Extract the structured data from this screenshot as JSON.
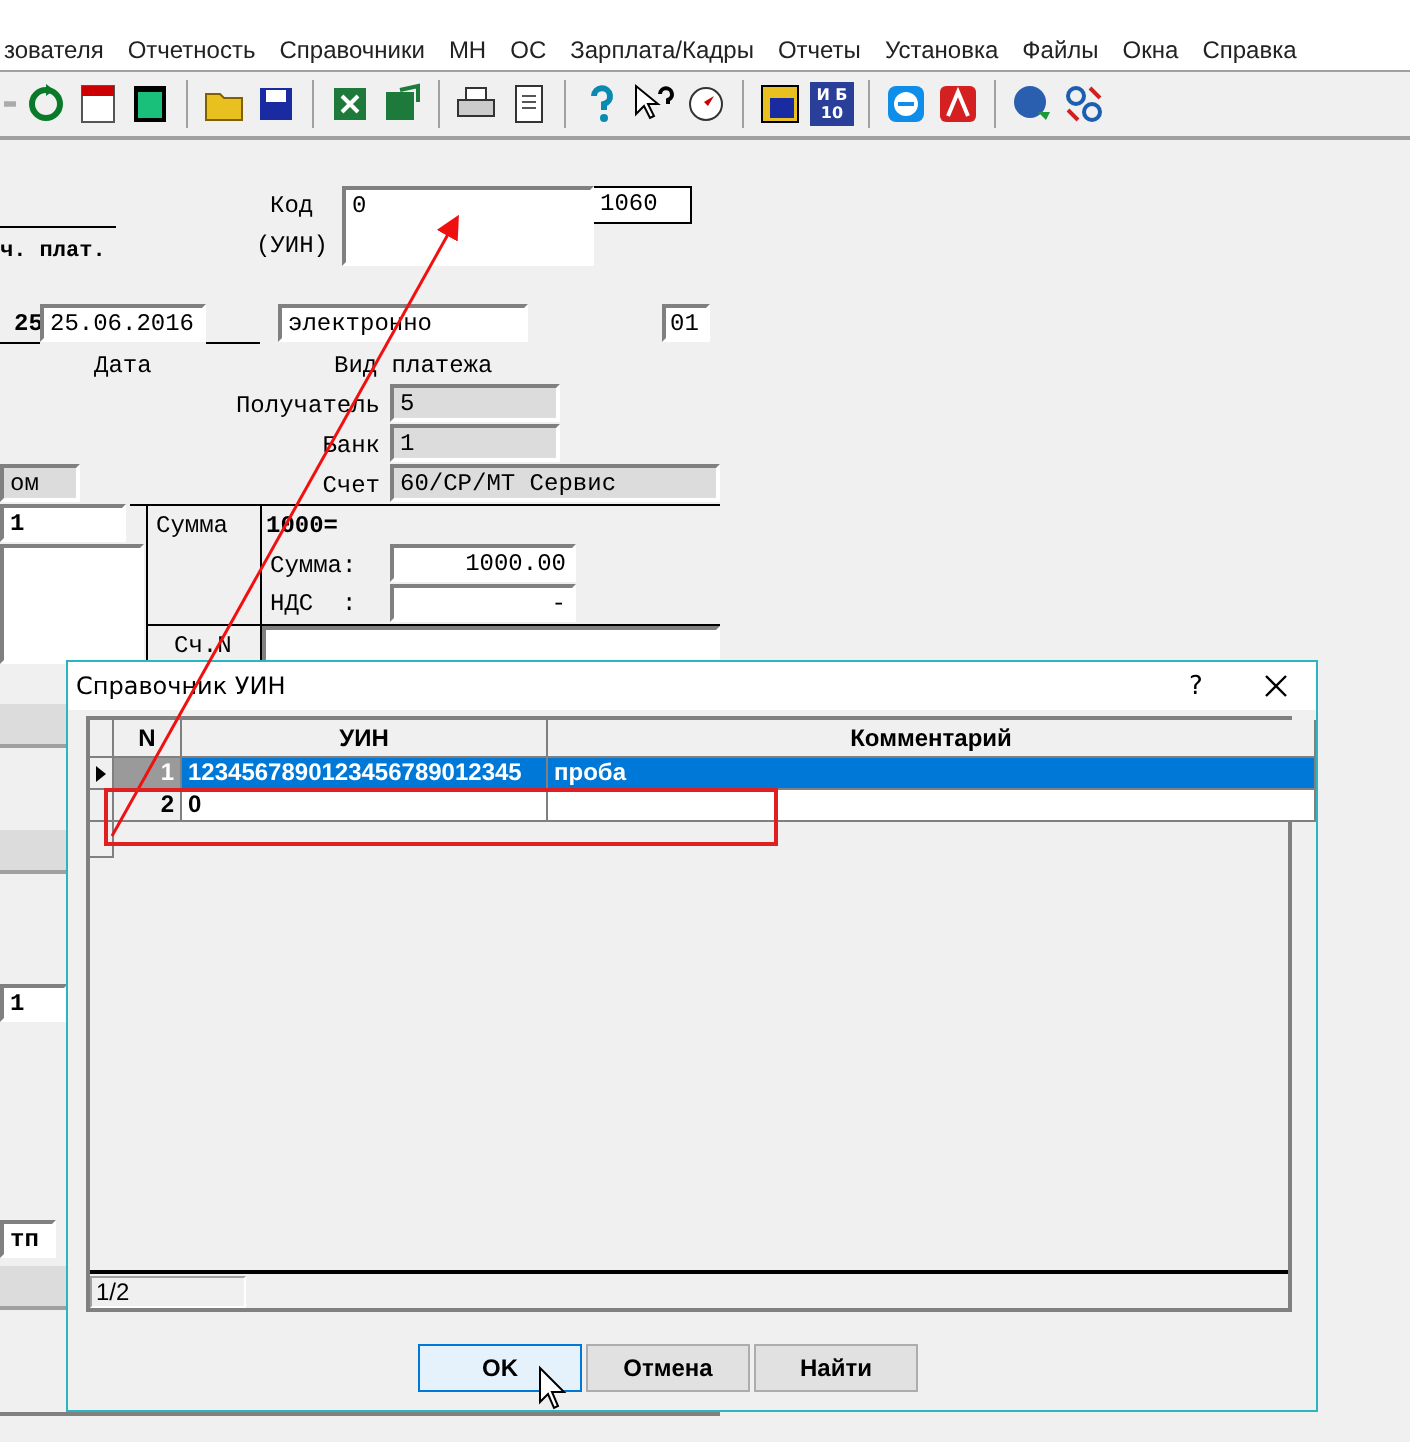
{
  "menu": [
    "зователя",
    "Отчетность",
    "Справочники",
    "МН",
    "ОС",
    "Зарплата/Кадры",
    "Отчеты",
    "Установка",
    "Файлы",
    "Окна",
    "Справка"
  ],
  "toolbar": {
    "badge_lines": [
      "И Б",
      "10"
    ]
  },
  "form": {
    "code": {
      "label": "Код",
      "sublabel": "(УИН)",
      "value": "0",
      "extra": "1060"
    },
    "payer_caption": "ч. плат.",
    "number_tail": "25",
    "date": {
      "value": "25.06.2016",
      "label": "Дата"
    },
    "payment_type": {
      "value": "электронно",
      "label": "Вид платежа"
    },
    "priority": "01",
    "recipient": {
      "label": "Получатель",
      "value": "5"
    },
    "bank": {
      "label": "Банк",
      "value": "1"
    },
    "account": {
      "label": "Счет",
      "value": "60/CP/MT Сервис"
    },
    "left_fields": [
      "ом",
      "1",
      "1",
      "тп"
    ],
    "sum": {
      "label": "Сумма",
      "total": "1000=",
      "amount_label": "Сумма:",
      "amount": "1000.00",
      "vat_label": "НДС  :",
      "vat": "-"
    },
    "invoice_label": "Сч.N"
  },
  "dialog": {
    "title": "Справочник УИН",
    "help": "?",
    "columns": [
      "N",
      "УИН",
      "Комментарий"
    ],
    "rows": [
      {
        "n": "1",
        "uin": "1234567890123456789012345",
        "comment": "проба",
        "selected": true
      },
      {
        "n": "2",
        "uin": "0",
        "selected": false
      }
    ],
    "record_counter": "1/2",
    "buttons": [
      {
        "label": "OK",
        "focused": true
      },
      {
        "label": "Отмена",
        "focused": false
      },
      {
        "label": "Найти",
        "focused": false
      }
    ]
  }
}
